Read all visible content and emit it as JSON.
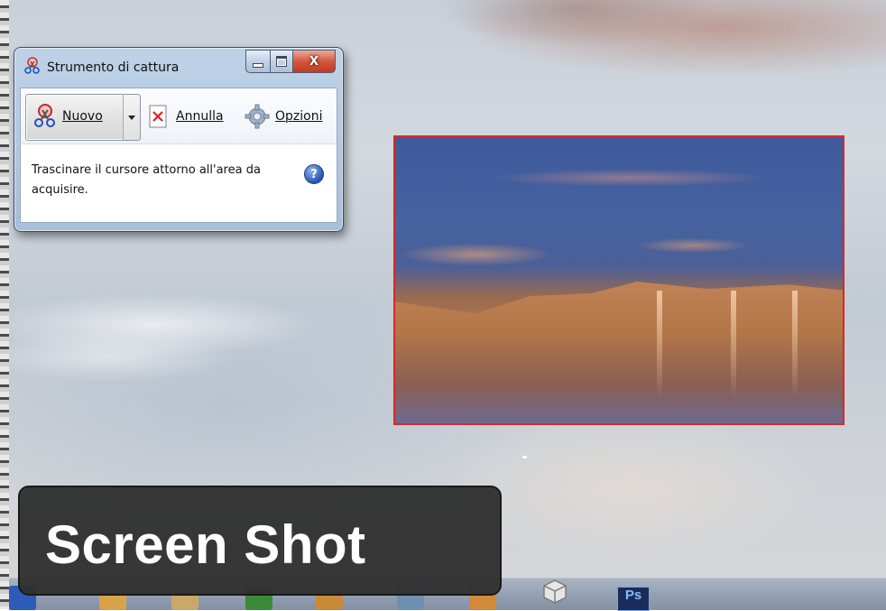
{
  "snipping_tool": {
    "title": "Strumento di cattura",
    "close_glyph": "X",
    "toolbar": {
      "new_label": "Nuovo",
      "cancel_label": "Annulla",
      "options_label": "Opzioni"
    },
    "instructions": "Trascinare il cursore attorno all'area da acquisire.",
    "help_glyph": "?"
  },
  "taskbar": {
    "ps_label": "Ps"
  },
  "caption": {
    "text": "Screen Shot"
  },
  "colors": {
    "selection_border": "#d62828",
    "caption_bg": "#303030",
    "caption_text": "#ffffff"
  },
  "icons": [
    "scissors-icon",
    "dropdown-arrow-icon",
    "cancel-x-icon",
    "gear-icon",
    "help-icon",
    "package-icon",
    "photoshop-icon"
  ]
}
